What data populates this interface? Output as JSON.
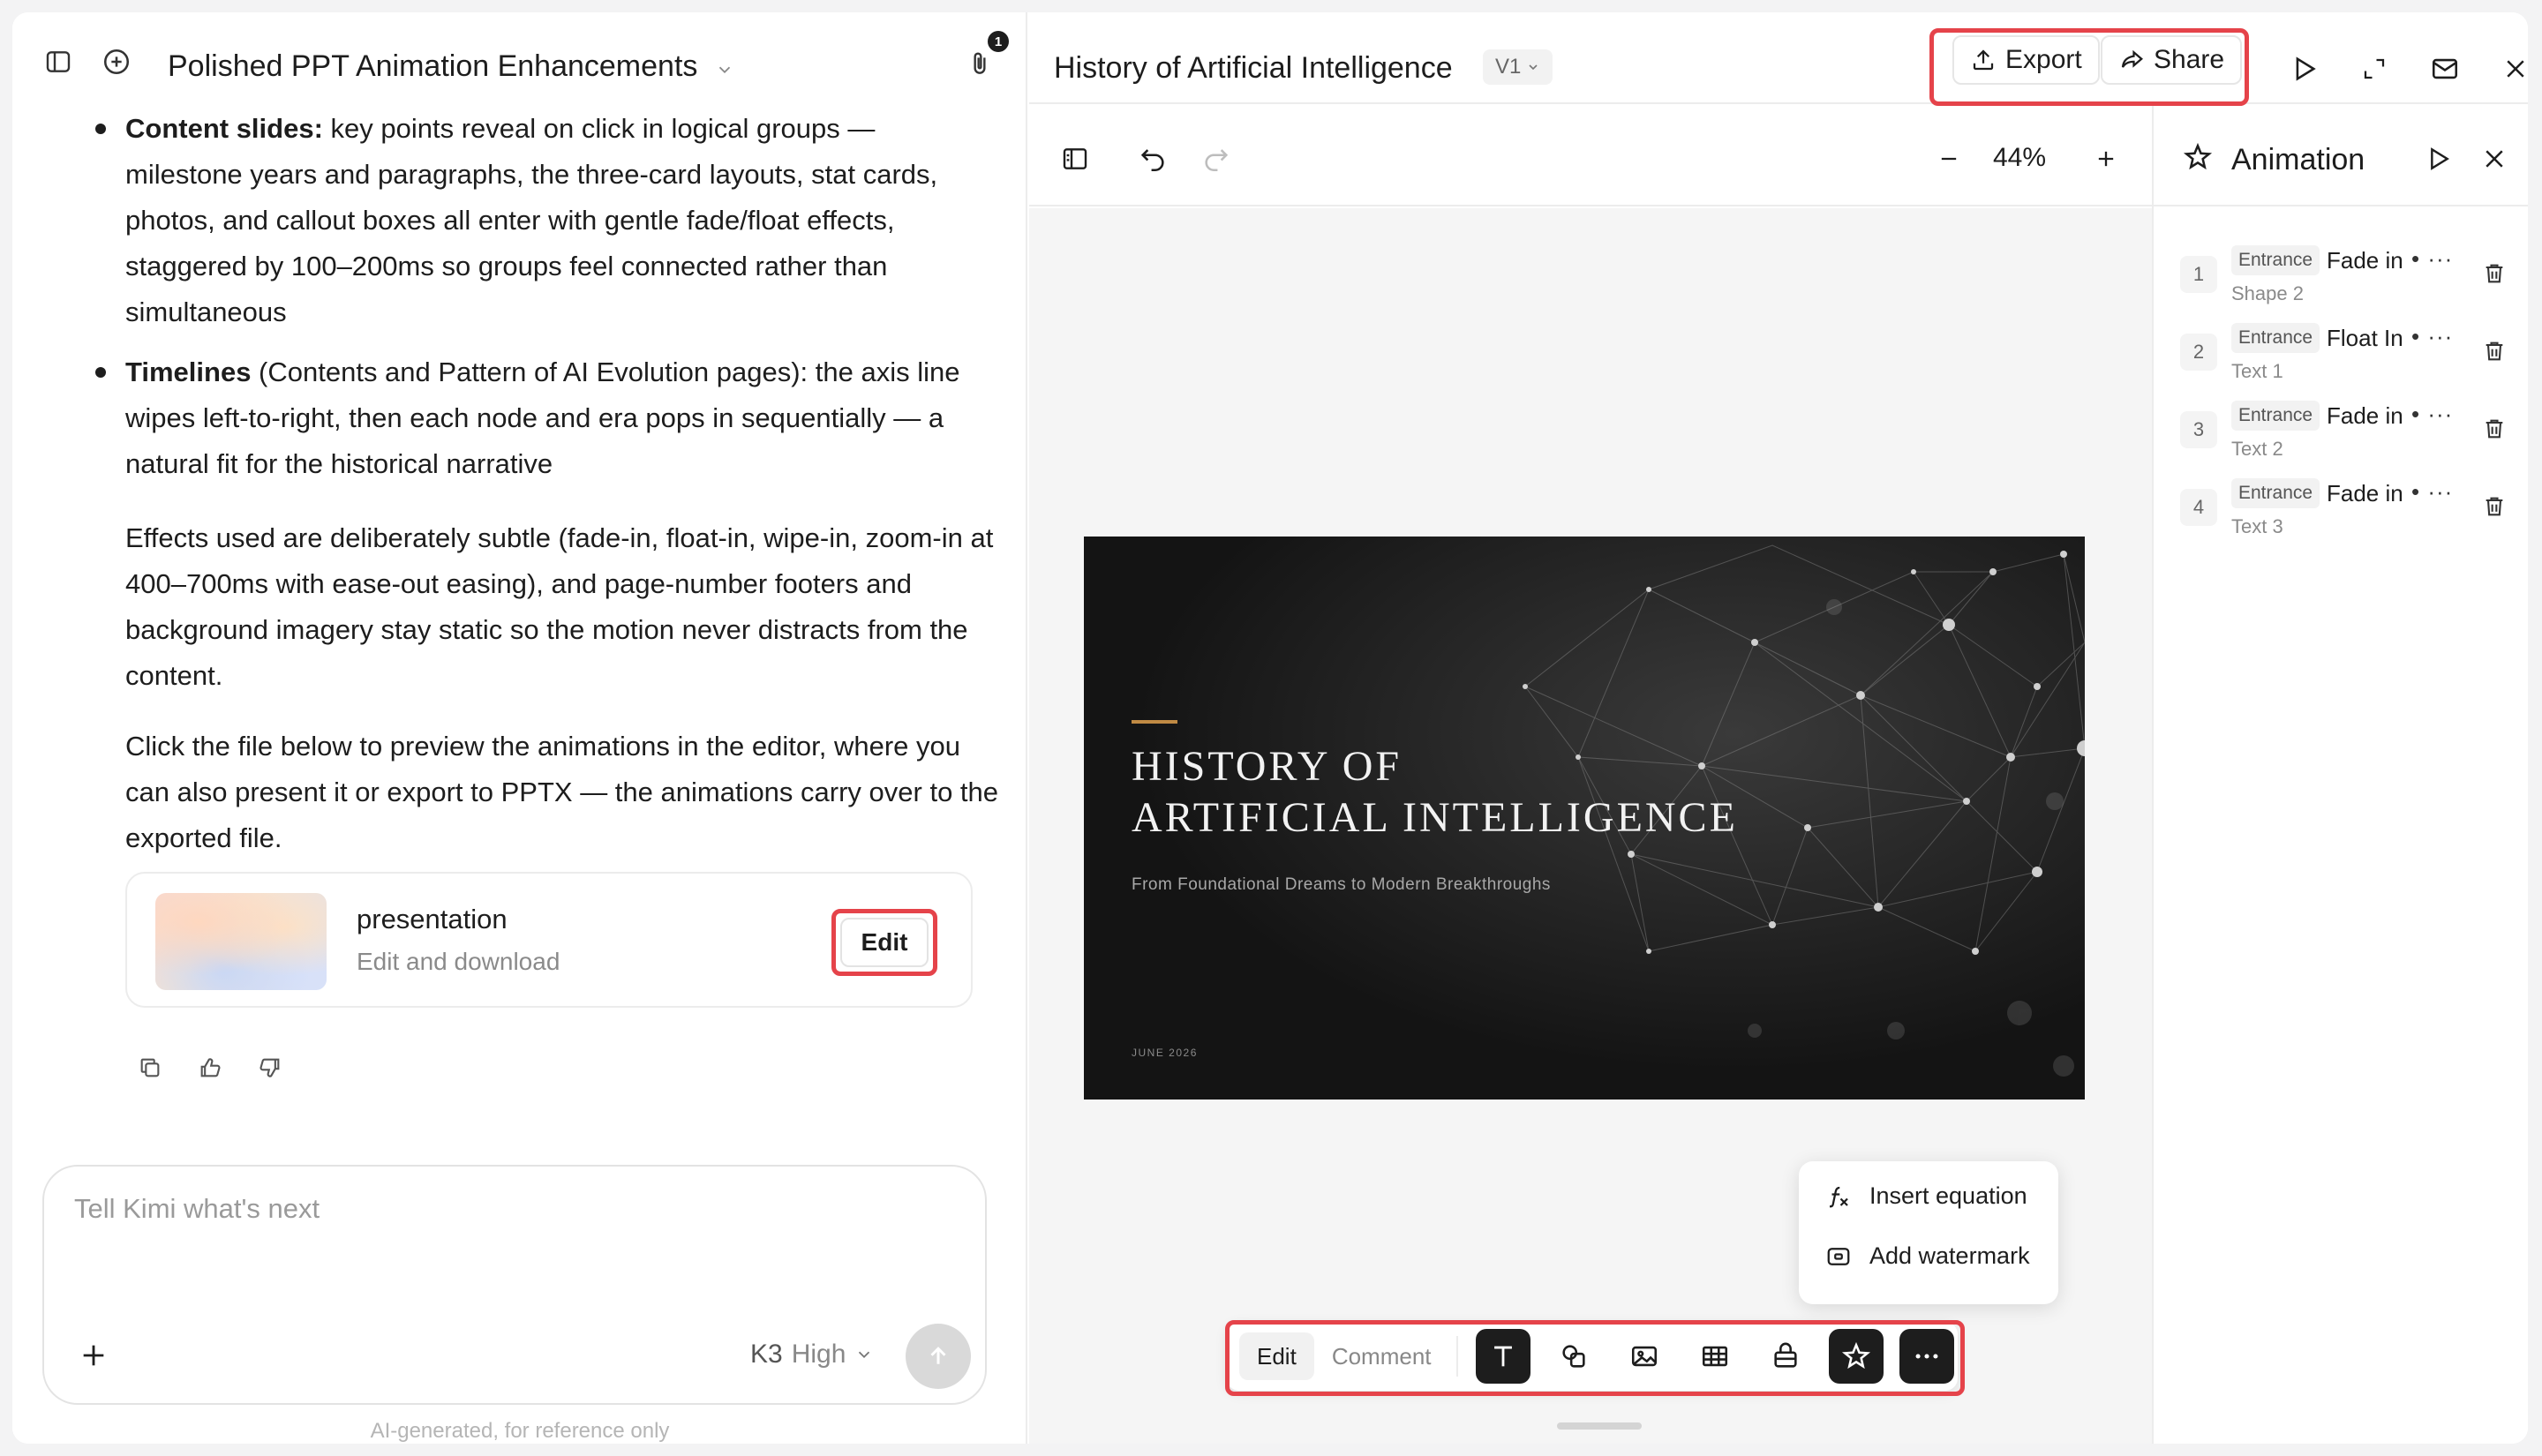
{
  "chat": {
    "title": "Polished PPT Animation Enhancements",
    "attachment_count": "1",
    "bullets": [
      {
        "bold": "Content slides:",
        "text": " key points reveal on click in logical groups — milestone years and paragraphs, the three-card layouts, stat cards, photos, and callout boxes all enter with gentle fade/float effects, staggered by 100–200ms so groups feel connected rather than simultaneous"
      },
      {
        "bold": "Timelines",
        "text": " (Contents and Pattern of AI Evolution pages): the axis line wipes left-to-right, then each node and era pops in sequentially — a natural fit for the historical narrative"
      }
    ],
    "paragraph1": "Effects used are deliberately subtle (fade-in, float-in, wipe-in, zoom-in at 400–700ms with ease-out easing), and page-number footers and background imagery stay static so the motion never distracts from the content.",
    "paragraph2": "Click the file below to preview the animations in the editor, where you can also present it or export to PPTX — the animations carry over to the exported file.",
    "file_card": {
      "name": "presentation",
      "subtitle": "Edit and download",
      "edit_label": "Edit"
    },
    "input": {
      "placeholder": "Tell Kimi what's next",
      "model": "K3",
      "level": "High"
    },
    "disclaimer": "AI-generated, for reference only"
  },
  "editor": {
    "doc_title": "History of Artificial Intelligence",
    "version": "V1",
    "export_label": "Export",
    "share_label": "Share",
    "zoom": "44%",
    "slide": {
      "title_line1": "HISTORY OF",
      "title_line2": "ARTIFICIAL INTELLIGENCE",
      "subtitle": "From Foundational Dreams to Modern Breakthroughs",
      "date": "JUNE 2026",
      "accent_color": "#c08a44"
    },
    "popup_menu": {
      "items": [
        {
          "label": "Insert equation",
          "icon": "function-icon"
        },
        {
          "label": "Add watermark",
          "icon": "watermark-icon"
        }
      ]
    },
    "bottom_bar": {
      "edit_label": "Edit",
      "comment_label": "Comment",
      "tools": [
        "text-icon",
        "shapes-icon",
        "image-icon",
        "table-icon",
        "chart-icon",
        "animation-icon",
        "more-icon"
      ]
    }
  },
  "animation_panel": {
    "title": "Animation",
    "items": [
      {
        "num": "1",
        "type": "Entrance",
        "effect": "Fade in",
        "target": "Shape 2"
      },
      {
        "num": "2",
        "type": "Entrance",
        "effect": "Float In",
        "target": "Text 1"
      },
      {
        "num": "3",
        "type": "Entrance",
        "effect": "Fade in",
        "target": "Text 2"
      },
      {
        "num": "4",
        "type": "Entrance",
        "effect": "Fade in",
        "target": "Text 3"
      }
    ]
  },
  "colors": {
    "highlight": "#e5434a",
    "dark": "#1d1d1d",
    "slide_bg": "#161616"
  }
}
